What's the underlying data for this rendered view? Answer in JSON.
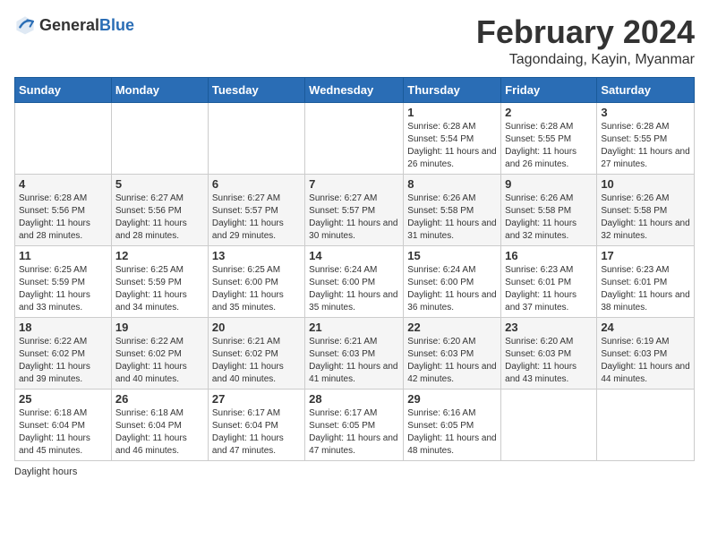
{
  "header": {
    "logo_general": "General",
    "logo_blue": "Blue",
    "month_title": "February 2024",
    "location": "Tagondaing, Kayin, Myanmar"
  },
  "days_of_week": [
    "Sunday",
    "Monday",
    "Tuesday",
    "Wednesday",
    "Thursday",
    "Friday",
    "Saturday"
  ],
  "weeks": [
    [
      {
        "day": "",
        "sunrise": "",
        "sunset": "",
        "daylight": ""
      },
      {
        "day": "",
        "sunrise": "",
        "sunset": "",
        "daylight": ""
      },
      {
        "day": "",
        "sunrise": "",
        "sunset": "",
        "daylight": ""
      },
      {
        "day": "",
        "sunrise": "",
        "sunset": "",
        "daylight": ""
      },
      {
        "day": "1",
        "sunrise": "Sunrise: 6:28 AM",
        "sunset": "Sunset: 5:54 PM",
        "daylight": "Daylight: 11 hours and 26 minutes."
      },
      {
        "day": "2",
        "sunrise": "Sunrise: 6:28 AM",
        "sunset": "Sunset: 5:55 PM",
        "daylight": "Daylight: 11 hours and 26 minutes."
      },
      {
        "day": "3",
        "sunrise": "Sunrise: 6:28 AM",
        "sunset": "Sunset: 5:55 PM",
        "daylight": "Daylight: 11 hours and 27 minutes."
      }
    ],
    [
      {
        "day": "4",
        "sunrise": "Sunrise: 6:28 AM",
        "sunset": "Sunset: 5:56 PM",
        "daylight": "Daylight: 11 hours and 28 minutes."
      },
      {
        "day": "5",
        "sunrise": "Sunrise: 6:27 AM",
        "sunset": "Sunset: 5:56 PM",
        "daylight": "Daylight: 11 hours and 28 minutes."
      },
      {
        "day": "6",
        "sunrise": "Sunrise: 6:27 AM",
        "sunset": "Sunset: 5:57 PM",
        "daylight": "Daylight: 11 hours and 29 minutes."
      },
      {
        "day": "7",
        "sunrise": "Sunrise: 6:27 AM",
        "sunset": "Sunset: 5:57 PM",
        "daylight": "Daylight: 11 hours and 30 minutes."
      },
      {
        "day": "8",
        "sunrise": "Sunrise: 6:26 AM",
        "sunset": "Sunset: 5:58 PM",
        "daylight": "Daylight: 11 hours and 31 minutes."
      },
      {
        "day": "9",
        "sunrise": "Sunrise: 6:26 AM",
        "sunset": "Sunset: 5:58 PM",
        "daylight": "Daylight: 11 hours and 32 minutes."
      },
      {
        "day": "10",
        "sunrise": "Sunrise: 6:26 AM",
        "sunset": "Sunset: 5:58 PM",
        "daylight": "Daylight: 11 hours and 32 minutes."
      }
    ],
    [
      {
        "day": "11",
        "sunrise": "Sunrise: 6:25 AM",
        "sunset": "Sunset: 5:59 PM",
        "daylight": "Daylight: 11 hours and 33 minutes."
      },
      {
        "day": "12",
        "sunrise": "Sunrise: 6:25 AM",
        "sunset": "Sunset: 5:59 PM",
        "daylight": "Daylight: 11 hours and 34 minutes."
      },
      {
        "day": "13",
        "sunrise": "Sunrise: 6:25 AM",
        "sunset": "Sunset: 6:00 PM",
        "daylight": "Daylight: 11 hours and 35 minutes."
      },
      {
        "day": "14",
        "sunrise": "Sunrise: 6:24 AM",
        "sunset": "Sunset: 6:00 PM",
        "daylight": "Daylight: 11 hours and 35 minutes."
      },
      {
        "day": "15",
        "sunrise": "Sunrise: 6:24 AM",
        "sunset": "Sunset: 6:00 PM",
        "daylight": "Daylight: 11 hours and 36 minutes."
      },
      {
        "day": "16",
        "sunrise": "Sunrise: 6:23 AM",
        "sunset": "Sunset: 6:01 PM",
        "daylight": "Daylight: 11 hours and 37 minutes."
      },
      {
        "day": "17",
        "sunrise": "Sunrise: 6:23 AM",
        "sunset": "Sunset: 6:01 PM",
        "daylight": "Daylight: 11 hours and 38 minutes."
      }
    ],
    [
      {
        "day": "18",
        "sunrise": "Sunrise: 6:22 AM",
        "sunset": "Sunset: 6:02 PM",
        "daylight": "Daylight: 11 hours and 39 minutes."
      },
      {
        "day": "19",
        "sunrise": "Sunrise: 6:22 AM",
        "sunset": "Sunset: 6:02 PM",
        "daylight": "Daylight: 11 hours and 40 minutes."
      },
      {
        "day": "20",
        "sunrise": "Sunrise: 6:21 AM",
        "sunset": "Sunset: 6:02 PM",
        "daylight": "Daylight: 11 hours and 40 minutes."
      },
      {
        "day": "21",
        "sunrise": "Sunrise: 6:21 AM",
        "sunset": "Sunset: 6:03 PM",
        "daylight": "Daylight: 11 hours and 41 minutes."
      },
      {
        "day": "22",
        "sunrise": "Sunrise: 6:20 AM",
        "sunset": "Sunset: 6:03 PM",
        "daylight": "Daylight: 11 hours and 42 minutes."
      },
      {
        "day": "23",
        "sunrise": "Sunrise: 6:20 AM",
        "sunset": "Sunset: 6:03 PM",
        "daylight": "Daylight: 11 hours and 43 minutes."
      },
      {
        "day": "24",
        "sunrise": "Sunrise: 6:19 AM",
        "sunset": "Sunset: 6:03 PM",
        "daylight": "Daylight: 11 hours and 44 minutes."
      }
    ],
    [
      {
        "day": "25",
        "sunrise": "Sunrise: 6:18 AM",
        "sunset": "Sunset: 6:04 PM",
        "daylight": "Daylight: 11 hours and 45 minutes."
      },
      {
        "day": "26",
        "sunrise": "Sunrise: 6:18 AM",
        "sunset": "Sunset: 6:04 PM",
        "daylight": "Daylight: 11 hours and 46 minutes."
      },
      {
        "day": "27",
        "sunrise": "Sunrise: 6:17 AM",
        "sunset": "Sunset: 6:04 PM",
        "daylight": "Daylight: 11 hours and 47 minutes."
      },
      {
        "day": "28",
        "sunrise": "Sunrise: 6:17 AM",
        "sunset": "Sunset: 6:05 PM",
        "daylight": "Daylight: 11 hours and 47 minutes."
      },
      {
        "day": "29",
        "sunrise": "Sunrise: 6:16 AM",
        "sunset": "Sunset: 6:05 PM",
        "daylight": "Daylight: 11 hours and 48 minutes."
      },
      {
        "day": "",
        "sunrise": "",
        "sunset": "",
        "daylight": ""
      },
      {
        "day": "",
        "sunrise": "",
        "sunset": "",
        "daylight": ""
      }
    ]
  ],
  "footer": {
    "daylight_label": "Daylight hours"
  }
}
